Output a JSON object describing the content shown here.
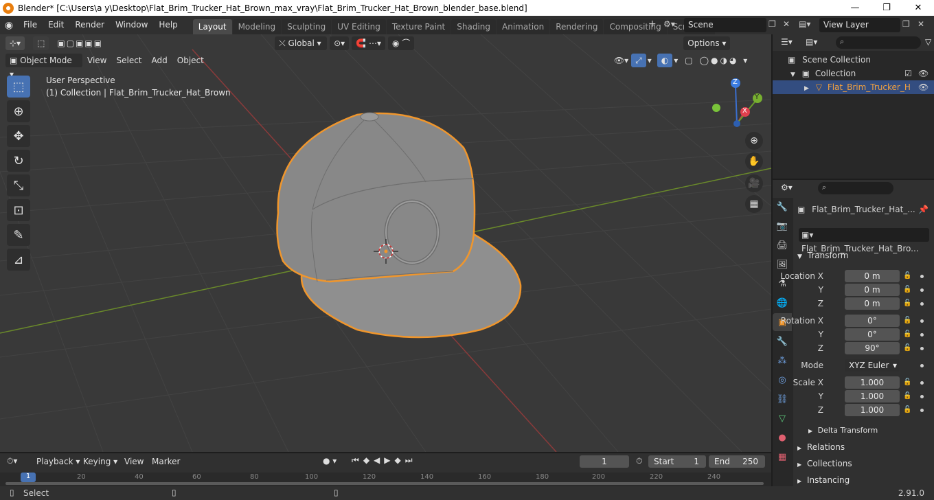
{
  "window": {
    "title": "Blender* [C:\\Users\\a y\\Desktop\\Flat_Brim_Trucker_Hat_Brown_max_vray\\Flat_Brim_Trucker_Hat_Brown_blender_base.blend]",
    "minimize": "—",
    "maximize": "❐",
    "close": "✕"
  },
  "menu": [
    "File",
    "Edit",
    "Render",
    "Window",
    "Help"
  ],
  "workspaces": [
    "Layout",
    "Modeling",
    "Sculpting",
    "UV Editing",
    "Texture Paint",
    "Shading",
    "Animation",
    "Rendering",
    "Compositing",
    "Scripting"
  ],
  "active_workspace": "Layout",
  "scene": {
    "name": "Scene",
    "view_layer": "View Layer"
  },
  "viewport": {
    "mode": "Object Mode",
    "header_menus": [
      "View",
      "Select",
      "Add",
      "Object"
    ],
    "transform_orientation": "Global",
    "options_label": "Options",
    "perspective_label": "User Perspective",
    "collection_label": "(1) Collection | Flat_Brim_Trucker_Hat_Brown",
    "gizmo_axes": {
      "x": "X",
      "y": "Y",
      "z": "Z"
    },
    "colors": {
      "background": "#393939",
      "grid": "#434343",
      "x_axis": "#8a3a3a",
      "y_axis": "#6a8a2a",
      "outline": "#f0962c",
      "hat": "#8c8c8c"
    }
  },
  "tools": [
    {
      "icon": "cursor-select-icon",
      "glyph": "⬚"
    },
    {
      "icon": "3d-cursor-icon",
      "glyph": "⊕"
    },
    {
      "icon": "move-icon",
      "glyph": "✥"
    },
    {
      "icon": "rotate-icon",
      "glyph": "↻"
    },
    {
      "icon": "scale-icon",
      "glyph": "⤡"
    },
    {
      "icon": "transform-icon",
      "glyph": "⊡"
    },
    {
      "icon": "annotate-icon",
      "glyph": "✎"
    },
    {
      "icon": "measure-icon",
      "glyph": "📐"
    }
  ],
  "outliner": {
    "search_placeholder": "",
    "items": [
      {
        "label": "Scene Collection",
        "indent": 0
      },
      {
        "label": "Collection",
        "indent": 1
      },
      {
        "label": "Flat_Brim_Trucker_H",
        "indent": 2,
        "selected": true
      }
    ]
  },
  "properties": {
    "object_name": "Flat_Brim_Trucker_Hat_...",
    "data_name": "Flat_Brim_Trucker_Hat_Bro...",
    "transform_label": "Transform",
    "location": {
      "label": "Location X",
      "x": "0 m",
      "y": "0 m",
      "z": "0 m"
    },
    "rotation": {
      "label": "Rotation X",
      "x": "0°",
      "y": "0°",
      "z": "90°"
    },
    "axis_labels": {
      "y": "Y",
      "z": "Z"
    },
    "mode_label": "Mode",
    "mode_value": "XYZ Euler",
    "scale": {
      "label": "Scale X",
      "x": "1.000",
      "y": "1.000",
      "z": "1.000"
    },
    "sections": [
      "Delta Transform",
      "Relations",
      "Collections",
      "Instancing"
    ]
  },
  "timeline": {
    "menus": [
      "Playback",
      "Keying",
      "View",
      "Marker"
    ],
    "current_frame": "1",
    "start_label": "Start",
    "start": "1",
    "end_label": "End",
    "end": "250",
    "ruler": [
      "1",
      "20",
      "40",
      "60",
      "80",
      "100",
      "120",
      "140",
      "160",
      "180",
      "200",
      "220",
      "240"
    ]
  },
  "status": {
    "left": "Select",
    "version": "2.91.0"
  }
}
